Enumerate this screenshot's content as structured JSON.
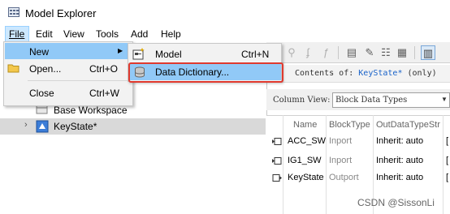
{
  "window": {
    "title": "Model Explorer"
  },
  "menubar": {
    "items": [
      "File",
      "Edit",
      "View",
      "Tools",
      "Add",
      "Help"
    ]
  },
  "file_menu": {
    "items": [
      {
        "label": "New",
        "shortcut": ""
      },
      {
        "label": "Open...",
        "shortcut": "Ctrl+O"
      },
      {
        "label": "Close",
        "shortcut": "Ctrl+W"
      }
    ]
  },
  "new_submenu": {
    "items": [
      {
        "label": "Model",
        "shortcut": "Ctrl+N"
      },
      {
        "label": "Data Dictionary..."
      }
    ]
  },
  "tree": {
    "items": [
      {
        "label": "Base Workspace"
      },
      {
        "label": "KeyState*"
      }
    ]
  },
  "contents": {
    "prefix": "Contents of:",
    "name": "KeyState*",
    "suffix": "(only)"
  },
  "column_view": {
    "label": "Column View:",
    "value": "Block Data Types"
  },
  "table": {
    "headers": [
      "Name",
      "BlockType",
      "OutDataTypeStr"
    ],
    "rows": [
      {
        "name": "ACC_SW",
        "block_type": "Inport",
        "out_type": "Inherit: auto"
      },
      {
        "name": "IG1_SW",
        "block_type": "Inport",
        "out_type": "Inherit: auto"
      },
      {
        "name": "KeyState",
        "block_type": "Outport",
        "out_type": "Inherit: auto"
      }
    ]
  },
  "watermark": "CSDN @SissonLi",
  "colors": {
    "selection": "#91c9f7",
    "highlight_box": "#e03a2f",
    "link": "#1a63c9"
  }
}
